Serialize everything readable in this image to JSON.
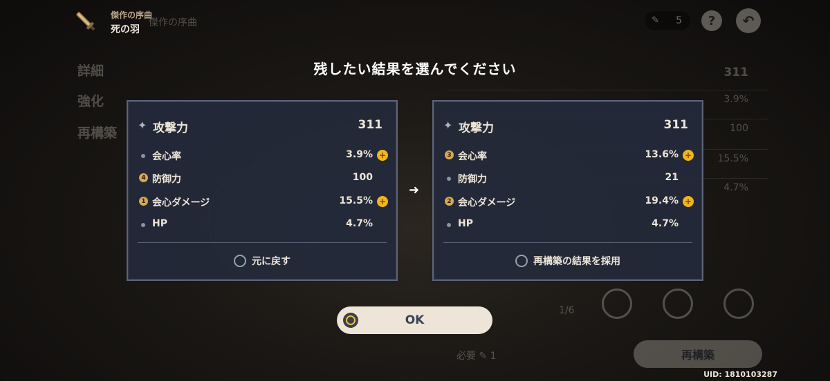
{
  "header": {
    "set_name": "傑作の序曲",
    "artifact_name": "死の羽",
    "currency_count": "5",
    "help_label": "?",
    "back_label": "↶"
  },
  "background": {
    "crumb": "傑作の序曲",
    "side_items": [
      "詳細",
      "強化",
      "再構築"
    ],
    "main_value": "311",
    "rows": [
      "3.9%",
      "100",
      "15.5%",
      "4.7%"
    ],
    "progress": "1/6",
    "need_label": "必要",
    "need_count": "1",
    "reroll_label": "再構築"
  },
  "modal": {
    "title": "残したい結果を選んでください",
    "left": {
      "main_stat": {
        "name": "攻撃力",
        "value": "311"
      },
      "substats": [
        {
          "marker": "bullet",
          "badge": "",
          "name": "会心率",
          "value": "3.9%",
          "roll": true
        },
        {
          "marker": "badge",
          "badge": "4",
          "name": "防御力",
          "value": "100",
          "roll": false
        },
        {
          "marker": "badge",
          "badge": "1",
          "name": "会心ダメージ",
          "value": "15.5%",
          "roll": true
        },
        {
          "marker": "bullet",
          "badge": "",
          "name": "HP",
          "value": "4.7%",
          "roll": false
        }
      ],
      "choice_label": "元に戻す"
    },
    "right": {
      "main_stat": {
        "name": "攻撃力",
        "value": "311"
      },
      "substats": [
        {
          "marker": "badge",
          "badge": "3",
          "name": "会心率",
          "value": "13.6%",
          "roll": true
        },
        {
          "marker": "bullet",
          "badge": "",
          "name": "防御力",
          "value": "21",
          "roll": false
        },
        {
          "marker": "badge",
          "badge": "2",
          "name": "会心ダメージ",
          "value": "19.4%",
          "roll": true
        },
        {
          "marker": "bullet",
          "badge": "",
          "name": "HP",
          "value": "4.7%",
          "roll": false
        }
      ],
      "choice_label": "再構築の結果を採用"
    },
    "arrow": "➜",
    "ok_label": "OK"
  },
  "footer": {
    "uid": "UID: 1810103287"
  },
  "colors": {
    "card_bg": "#232a3a",
    "card_border": "#5b6478",
    "badge_gold": "#d9a94e",
    "roll_gold": "#f2b41f",
    "button_bg": "#ece5d8"
  }
}
